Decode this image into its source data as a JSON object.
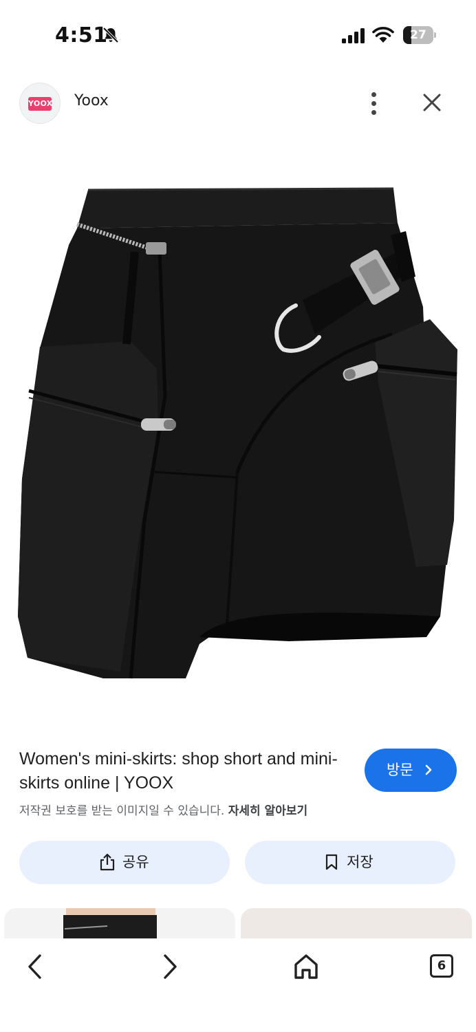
{
  "status_bar": {
    "time": "4:51",
    "battery": "27",
    "battery_level": 0.27,
    "icons": [
      "bell-off-icon",
      "cellular-signal-icon",
      "wifi-icon",
      "battery-icon"
    ]
  },
  "header": {
    "logo_text": "YOOX",
    "site_name": "Yoox",
    "more_icon": "more-vertical-icon",
    "close_icon": "close-icon"
  },
  "image": {
    "subject": "black asymmetric cargo mini skirt"
  },
  "result": {
    "title": "Women's mini-skirts: shop short and mini-skirts online | YOOX",
    "visit_label": "방문",
    "copyright_notice": "저작권 보호를 받는 이미지일 수 있습니다.",
    "learn_more": "자세히 알아보기"
  },
  "actions": {
    "share_label": "공유",
    "save_label": "저장"
  },
  "bottom_nav": {
    "tab_count": "6",
    "icons": [
      "back-icon",
      "forward-icon",
      "home-icon",
      "tabs-icon"
    ]
  },
  "colors": {
    "accent": "#1a73e8",
    "action_bg": "#e8f0fe",
    "logo_bg": "#ec3f6e"
  }
}
